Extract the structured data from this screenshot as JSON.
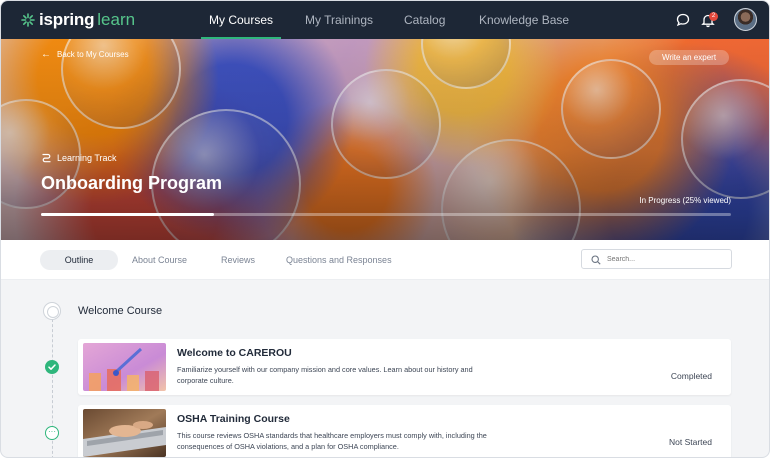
{
  "app": {
    "logo_brand": "ispring",
    "logo_product": "learn"
  },
  "nav": {
    "items": [
      {
        "label": "My Courses",
        "active": true
      },
      {
        "label": "My Trainings",
        "active": false
      },
      {
        "label": "Catalog",
        "active": false
      },
      {
        "label": "Knowledge Base",
        "active": false
      }
    ],
    "notification_count": "2",
    "icons": [
      "chat-icon",
      "bell-icon",
      "avatar"
    ]
  },
  "hero": {
    "back_label": "Back to My Courses",
    "expert_button": "Write an expert",
    "type_label": "Learning Track",
    "title": "Onboarding Program",
    "progress_text": "In Progress (25% viewed)",
    "progress_fraction": 0.25
  },
  "tabs": [
    {
      "label": "Outline",
      "active": true
    },
    {
      "label": "About Course",
      "active": false
    },
    {
      "label": "Reviews",
      "active": false
    },
    {
      "label": "Questions and Responses",
      "active": false
    }
  ],
  "search": {
    "placeholder": "Search...",
    "value": ""
  },
  "outline": {
    "section_title": "Welcome Course",
    "courses": [
      {
        "title": "Welcome to CAREROU",
        "description": "Familiarize yourself with our company mission and core values. Learn about our history and corporate culture.",
        "status": "Completed",
        "status_icon": "check-icon"
      },
      {
        "title": "OSHA Training Course",
        "description": "This course reviews OSHA standards that healthcare employers must comply with, including the consequences of OSHA violations, and a plan for OSHA compliance.",
        "status": "Not Started",
        "status_icon": "more-icon"
      }
    ]
  },
  "colors": {
    "nav_bg": "#1d2736",
    "accent_green": "#2fb67c",
    "badge_red": "#e4493d"
  }
}
